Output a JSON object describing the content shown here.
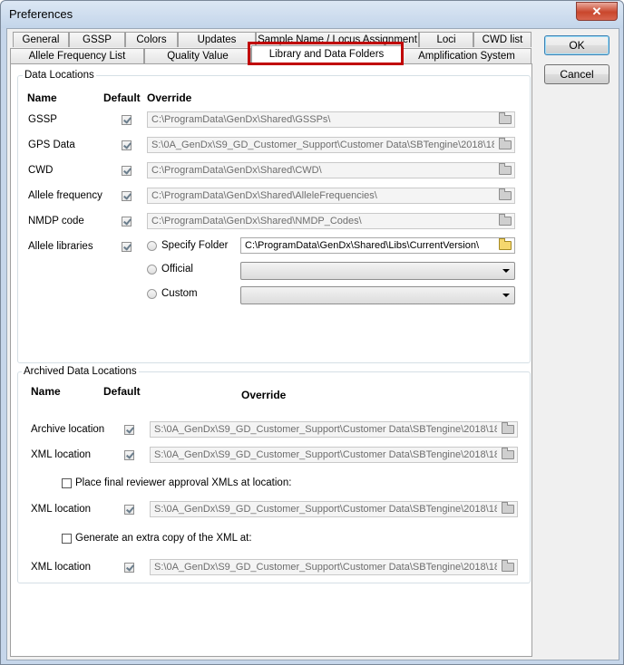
{
  "window": {
    "title": "Preferences"
  },
  "tabs_row1": [
    "General",
    "GSSP",
    "Colors",
    "Updates",
    "Sample Name / Locus Assignment",
    "Loci",
    "CWD list"
  ],
  "tabs_row2": [
    "Allele Frequency List",
    "Quality Value",
    "Library and Data Folders",
    "Amplification System"
  ],
  "active_tab": "Library and Data Folders",
  "highlight_color": "#c00000",
  "data_locations": {
    "title": "Data Locations",
    "headers": {
      "name": "Name",
      "default": "Default",
      "override": "Override"
    },
    "rows": [
      {
        "name": "GSSP",
        "default_checked": true,
        "path": "C:\\ProgramData\\GenDx\\Shared\\GSSPs\\"
      },
      {
        "name": "GPS Data",
        "default_checked": true,
        "path": "S:\\0A_GenDx\\S9_GD_Customer_Support\\Customer Data\\SBTengine\\2018\\18"
      },
      {
        "name": "CWD",
        "default_checked": true,
        "path": "C:\\ProgramData\\GenDx\\Shared\\CWD\\"
      },
      {
        "name": "Allele frequency",
        "default_checked": true,
        "path": "C:\\ProgramData\\GenDx\\Shared\\AlleleFrequencies\\"
      },
      {
        "name": "NMDP code",
        "default_checked": true,
        "path": "C:\\ProgramData\\GenDx\\Shared\\NMDP_Codes\\"
      }
    ],
    "allele_libraries": {
      "name": "Allele libraries",
      "default_checked": true,
      "specify_folder_label": "Specify Folder",
      "specify_folder_path": "C:\\ProgramData\\GenDx\\Shared\\Libs\\CurrentVersion\\",
      "official_label": "Official",
      "official_value": "",
      "custom_label": "Custom",
      "custom_value": ""
    }
  },
  "archived": {
    "title": "Archived Data Locations",
    "headers": {
      "name": "Name",
      "default": "Default",
      "override": "Override"
    },
    "archive_location": {
      "name": "Archive location",
      "path": "S:\\0A_GenDx\\S9_GD_Customer_Support\\Customer Data\\SBTengine\\2018\\18"
    },
    "xml_location": {
      "name": "XML location",
      "path": "S:\\0A_GenDx\\S9_GD_Customer_Support\\Customer Data\\SBTengine\\2018\\18"
    },
    "place_final_label": "Place final reviewer approval XMLs at location:",
    "xml_location_2": {
      "name": "XML location",
      "path": "S:\\0A_GenDx\\S9_GD_Customer_Support\\Customer Data\\SBTengine\\2018\\18"
    },
    "extra_copy_label": "Generate an extra copy of the XML at:",
    "xml_location_3": {
      "name": "XML location",
      "path": "S:\\0A_GenDx\\S9_GD_Customer_Support\\Customer Data\\SBTengine\\2018\\18"
    }
  },
  "buttons": {
    "ok": "OK",
    "cancel": "Cancel"
  }
}
